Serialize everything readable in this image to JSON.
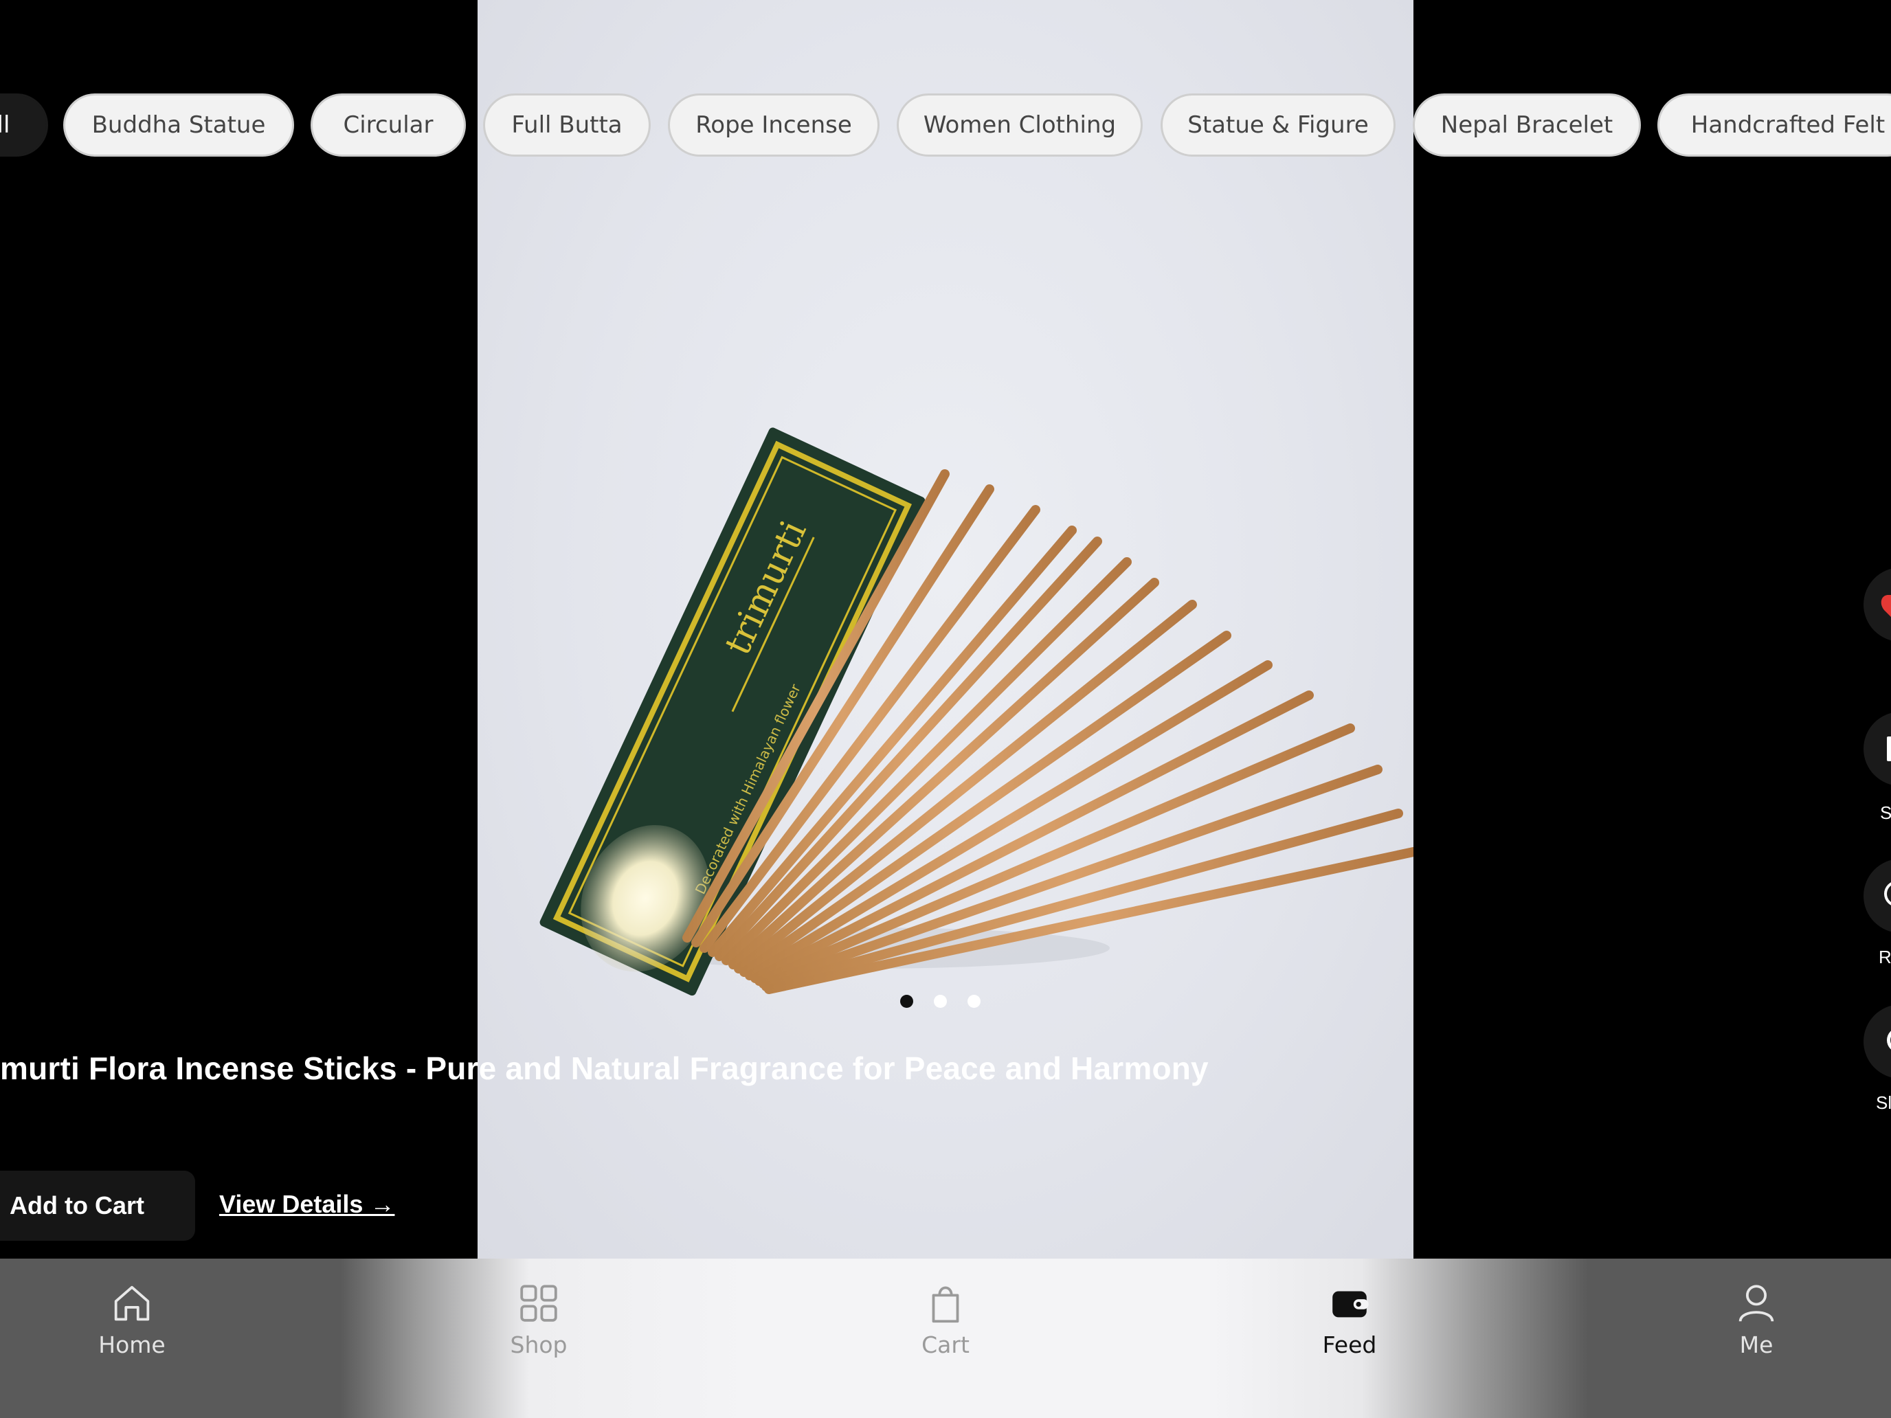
{
  "categories": [
    {
      "label": "ll",
      "active": true
    },
    {
      "label": "Buddha Statue"
    },
    {
      "label": "Circular"
    },
    {
      "label": "Full Butta"
    },
    {
      "label": "Rope Incense"
    },
    {
      "label": "Women Clothing"
    },
    {
      "label": "Statue & Figure"
    },
    {
      "label": "Nepal Bracelet"
    },
    {
      "label": "Handcrafted Felt"
    }
  ],
  "product": {
    "title": "murti Flora Incense Sticks - Pure and Natural Fragrance for Peace and Harmony",
    "image_dots": 3,
    "active_dot": 0
  },
  "actions": {
    "add_to_cart": "Add to Cart",
    "view_details": "View Details →"
  },
  "rail": {
    "labels": [
      "S",
      "R",
      "Sl"
    ]
  },
  "bottom_nav": [
    {
      "label": "Home",
      "icon": "home-icon"
    },
    {
      "label": "Shop",
      "icon": "grid-icon"
    },
    {
      "label": "Cart",
      "icon": "bag-icon"
    },
    {
      "label": "Feed",
      "icon": "wallet-icon",
      "active": true
    },
    {
      "label": "Me",
      "icon": "user-icon"
    }
  ],
  "colors": {
    "background": "#000000",
    "chip_bg": "#f2f2f2",
    "like_red": "#e53935"
  }
}
